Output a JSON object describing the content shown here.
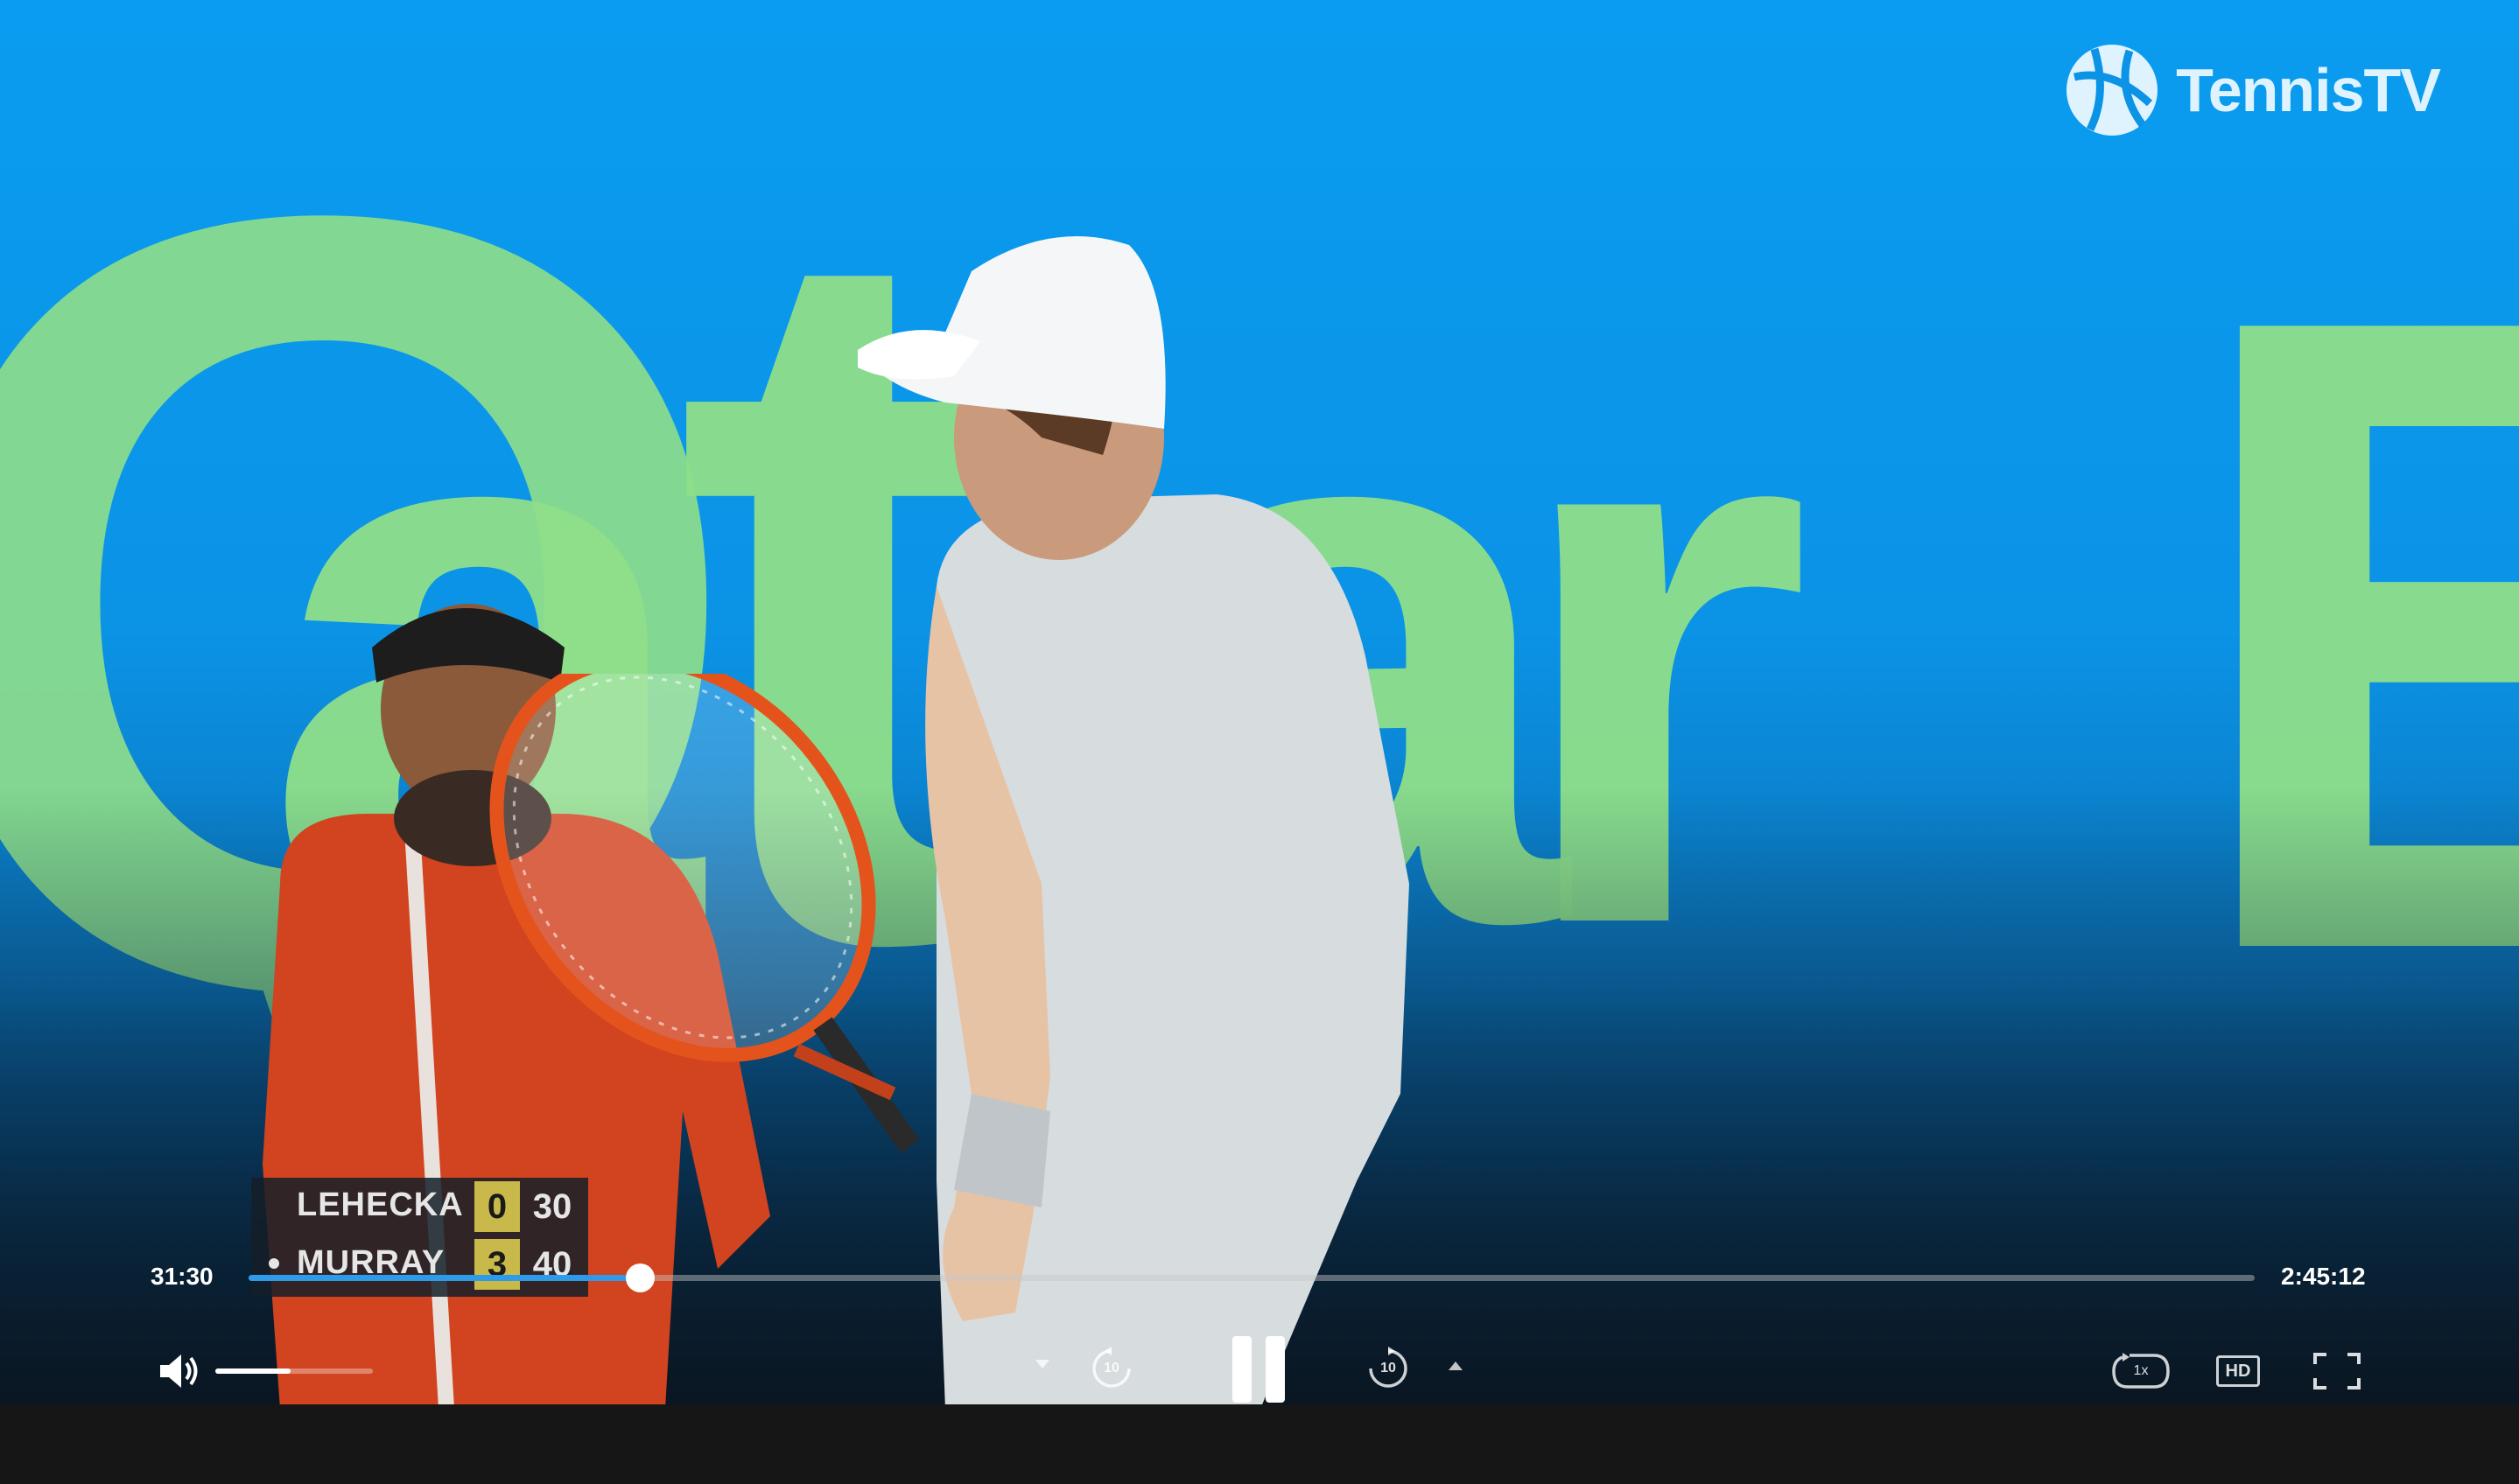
{
  "brand": {
    "name": "TennisTV"
  },
  "scoreboard": {
    "players": [
      {
        "name": "LEHECKA",
        "sets": "0",
        "points": "30",
        "serving": false
      },
      {
        "name": "MURRAY",
        "sets": "3",
        "points": "40",
        "serving": true
      }
    ]
  },
  "player_controls": {
    "current_time": "31:30",
    "duration": "2:45:12",
    "progress": 0.195,
    "volume": 0.48,
    "playback_speed_label": "1x",
    "quality_label": "HD",
    "rewind_seconds": "10",
    "forward_seconds": "10",
    "accent_color": "#2f9be8"
  },
  "signage": {
    "letters": [
      "Q",
      "a",
      "t",
      "a",
      "r",
      "E"
    ]
  }
}
